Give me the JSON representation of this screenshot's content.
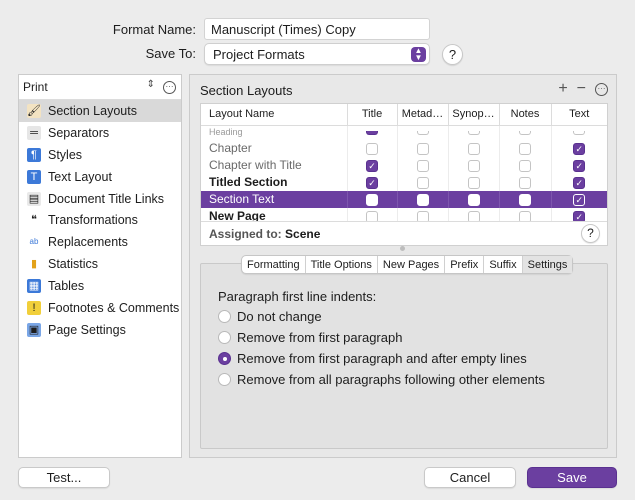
{
  "header": {
    "format_name_label": "Format Name:",
    "format_name_value": "Manuscript (Times) Copy",
    "save_to_label": "Save To:",
    "save_to_value": "Project Formats",
    "help_glyph": "?"
  },
  "sidebar": {
    "header_label": "Print",
    "items": [
      {
        "label": "Section Layouts",
        "icon": "brush-icon",
        "selected": true
      },
      {
        "label": "Separators",
        "icon": "separators-icon"
      },
      {
        "label": "Styles",
        "icon": "styles-icon"
      },
      {
        "label": "Text Layout",
        "icon": "text-layout-icon"
      },
      {
        "label": "Document Title Links",
        "icon": "document-icon"
      },
      {
        "label": "Transformations",
        "icon": "quotes-icon"
      },
      {
        "label": "Replacements",
        "icon": "replacements-icon"
      },
      {
        "label": "Statistics",
        "icon": "bar-chart-icon"
      },
      {
        "label": "Tables",
        "icon": "table-icon"
      },
      {
        "label": "Footnotes & Comments",
        "icon": "footnote-icon"
      },
      {
        "label": "Page Settings",
        "icon": "page-settings-icon"
      }
    ]
  },
  "section_layouts": {
    "title": "Section Layouts",
    "add_glyph": "+",
    "remove_glyph": "−",
    "columns": [
      "Layout Name",
      "Title",
      "Metad…",
      "Synop…",
      "Notes",
      "Text"
    ],
    "rows": [
      {
        "name": "Heading",
        "partial": true,
        "title": true,
        "meta": false,
        "synop": false,
        "notes": false,
        "text": false
      },
      {
        "name": "Chapter",
        "title": false,
        "meta": false,
        "synop": false,
        "notes": false,
        "text": true
      },
      {
        "name": "Chapter with Title",
        "title": true,
        "meta": false,
        "synop": false,
        "notes": false,
        "text": true
      },
      {
        "name": "Titled Section",
        "bold": true,
        "title": true,
        "meta": false,
        "synop": false,
        "notes": false,
        "text": true
      },
      {
        "name": "Section Text",
        "selected": true,
        "title": false,
        "meta": false,
        "synop": false,
        "notes": false,
        "text": true
      },
      {
        "name": "New Page",
        "bold": true,
        "title": false,
        "meta": false,
        "synop": false,
        "notes": false,
        "text": true
      }
    ],
    "assigned_label": "Assigned to:",
    "assigned_value": "Scene"
  },
  "tabs": [
    "Formatting",
    "Title Options",
    "New Pages",
    "Prefix",
    "Suffix",
    "Settings"
  ],
  "active_tab": "Settings",
  "settings": {
    "group_label": "Paragraph first line indents:",
    "options": [
      {
        "label": "Do not change",
        "checked": false
      },
      {
        "label": "Remove from first paragraph",
        "checked": false
      },
      {
        "label": "Remove from first paragraph and after empty lines",
        "checked": true
      },
      {
        "label": "Remove from all paragraphs following other elements",
        "checked": false
      }
    ]
  },
  "buttons": {
    "test": "Test...",
    "cancel": "Cancel",
    "save": "Save"
  },
  "colors": {
    "accent": "#6b3fa0",
    "window_bg": "#ececec"
  }
}
